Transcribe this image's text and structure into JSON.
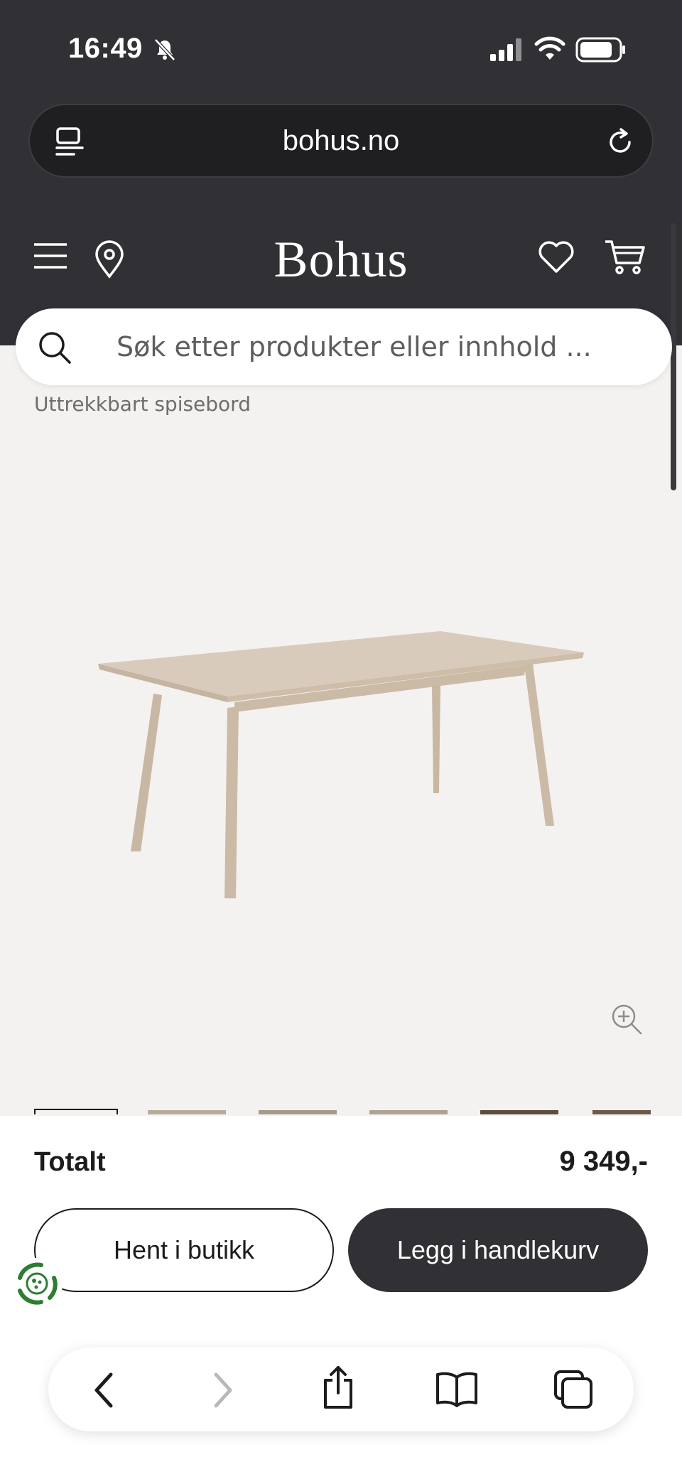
{
  "status_bar": {
    "time": "16:49",
    "icons": [
      "bell-slash-icon",
      "signal-icon",
      "wifi-icon",
      "battery-icon"
    ]
  },
  "browser": {
    "url": "bohus.no",
    "toolbar_icons": [
      "back-icon",
      "forward-icon",
      "share-icon",
      "bookmarks-icon",
      "tabs-icon"
    ]
  },
  "header": {
    "logo": "Bohus",
    "icons": [
      "menu-icon",
      "location-icon",
      "heart-icon",
      "cart-icon"
    ]
  },
  "search": {
    "placeholder": "Søk etter produkter eller innhold ..."
  },
  "product": {
    "category": "Uttrekkbart spisebord",
    "image": "dining-table-image",
    "thumbnail_count": 6
  },
  "purchase": {
    "total_label": "Totalt",
    "total_price": "9 349,-",
    "pickup_button": "Hent i butikk",
    "add_to_cart_button": "Legg i handlekurv"
  },
  "colors": {
    "header_bg": "#313035",
    "page_bg": "#f4f2f0",
    "accent_dark": "#313035",
    "eco_green": "#2e7d32"
  }
}
